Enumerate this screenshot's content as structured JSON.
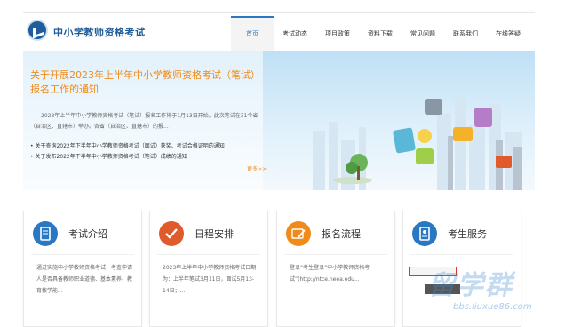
{
  "header": {
    "site_name": "中小学教师资格考试",
    "nav": [
      "首页",
      "考试动态",
      "项目政策",
      "资料下载",
      "常见问题",
      "联系我们",
      "在线答疑"
    ]
  },
  "banner": {
    "title": "关于开展2023年上半年中小学教师资格考试（笔试）报名工作的通知",
    "paragraph": "2023年上半年中小学教师资格考试（笔试）报名工作将于1月13日开始。此次笔试在31个省（自治区、直辖市）举办。各省（自治区、直辖市）的报...",
    "links": [
      "关于查询2022年下半年中小学教师资格考试（面试）获奖、考试合格证明的通知",
      "关于发布2022年下半年中小学教师资格考试（笔试）成绩的通知"
    ],
    "more": "更多>>"
  },
  "cards": [
    {
      "title": "考试介绍",
      "text": "通过实施中小学教师资格考试，考查申请人是否具备教师职业道德、基本素养、教育教学能...",
      "icon": "document-icon",
      "color": "#2a78c2"
    },
    {
      "title": "日程安排",
      "text": "2023年上半年中小学教师资格考试日期为：上半年笔试3月11日，面试5月13-14日；...",
      "icon": "check-icon",
      "color": "#e05a2b"
    },
    {
      "title": "报名流程",
      "text": "登录“考生登录”中小学教师资格考试”(http://ntce.neea.edu...",
      "icon": "pencil-icon",
      "color": "#f08a18"
    },
    {
      "title": "考生服务",
      "text": "",
      "icon": "contact-icon",
      "color": "#2a78c2"
    }
  ],
  "watermark": {
    "text": "留学群",
    "url": "bbs.liuxue86.com"
  }
}
